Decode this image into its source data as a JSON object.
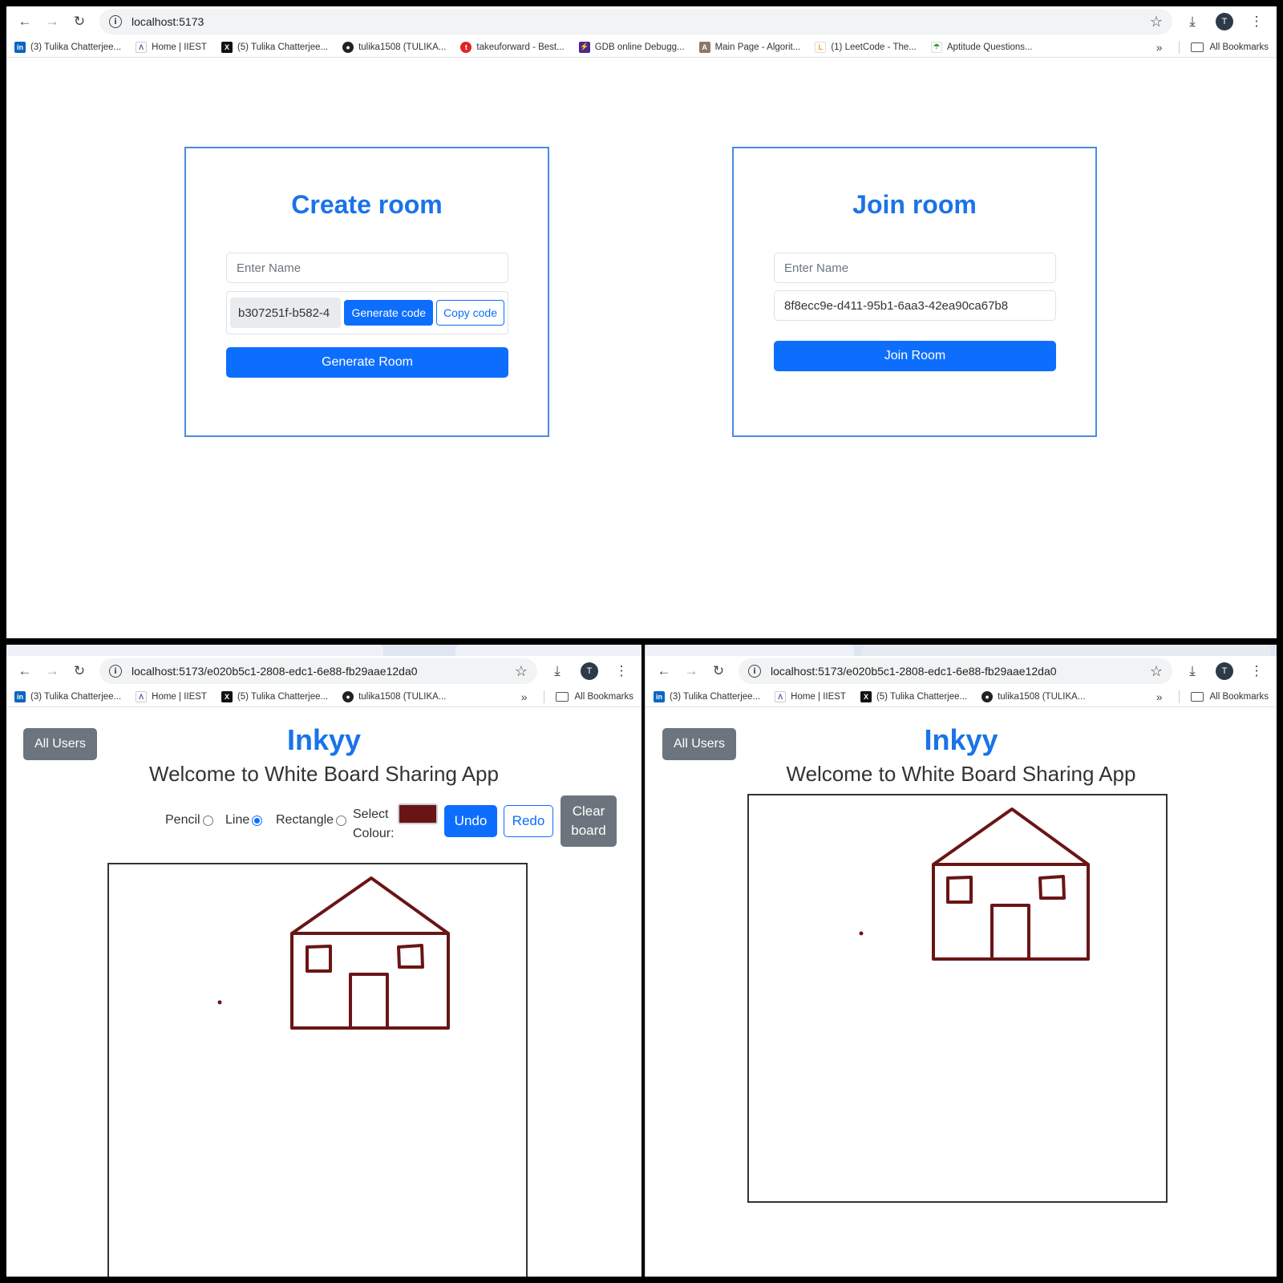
{
  "top": {
    "url": "localhost:5173",
    "bookmarks": [
      {
        "label": "(3) Tulika Chatterjee...",
        "icon": "linkedin-icon"
      },
      {
        "label": "Home | IIEST",
        "icon": "iiest-icon"
      },
      {
        "label": "(5) Tulika Chatterjee...",
        "icon": "x-icon"
      },
      {
        "label": "tulika1508 (TULIKA...",
        "icon": "github-icon"
      },
      {
        "label": "takeuforward - Best...",
        "icon": "takeuforward-icon"
      },
      {
        "label": "GDB online Debugg...",
        "icon": "gdb-icon"
      },
      {
        "label": "Main Page - Algorit...",
        "icon": "algorithmica-icon"
      },
      {
        "label": "(1) LeetCode - The...",
        "icon": "leetcode-icon"
      },
      {
        "label": "Aptitude Questions...",
        "icon": "indiabix-icon"
      }
    ],
    "all_bookmarks": "All Bookmarks",
    "avatar": "T",
    "create": {
      "title": "Create room",
      "name_placeholder": "Enter Name",
      "code": "b307251f-b582-4",
      "generate_code": "Generate code",
      "copy_code": "Copy code",
      "submit": "Generate Room"
    },
    "join": {
      "title": "Join room",
      "name_placeholder": "Enter Name",
      "code": "8f8ecc9e-d411-95b1-6aa3-42ea90ca67b8",
      "submit": "Join Room"
    }
  },
  "room": {
    "url": "localhost:5173/e020b5c1-2808-edc1-6e88-fb29aae12da0",
    "bookmarks": [
      {
        "label": "(3) Tulika Chatterjee...",
        "icon": "linkedin-icon"
      },
      {
        "label": "Home | IIEST",
        "icon": "iiest-icon"
      },
      {
        "label": "(5) Tulika Chatterjee...",
        "icon": "x-icon"
      },
      {
        "label": "tulika1508 (TULIKA...",
        "icon": "github-icon"
      }
    ],
    "all_bookmarks": "All Bookmarks",
    "avatar": "T",
    "all_users": "All Users",
    "brand": "Inkyy",
    "welcome": "Welcome to White Board Sharing App",
    "tools": {
      "pencil": "Pencil",
      "line": "Line",
      "rectangle": "Rectangle",
      "selected": "line"
    },
    "select_colour": "Select",
    "select_colour_2": "Colour:",
    "colour": "#6a1515",
    "undo": "Undo",
    "redo": "Redo",
    "clear": "Clear board"
  }
}
